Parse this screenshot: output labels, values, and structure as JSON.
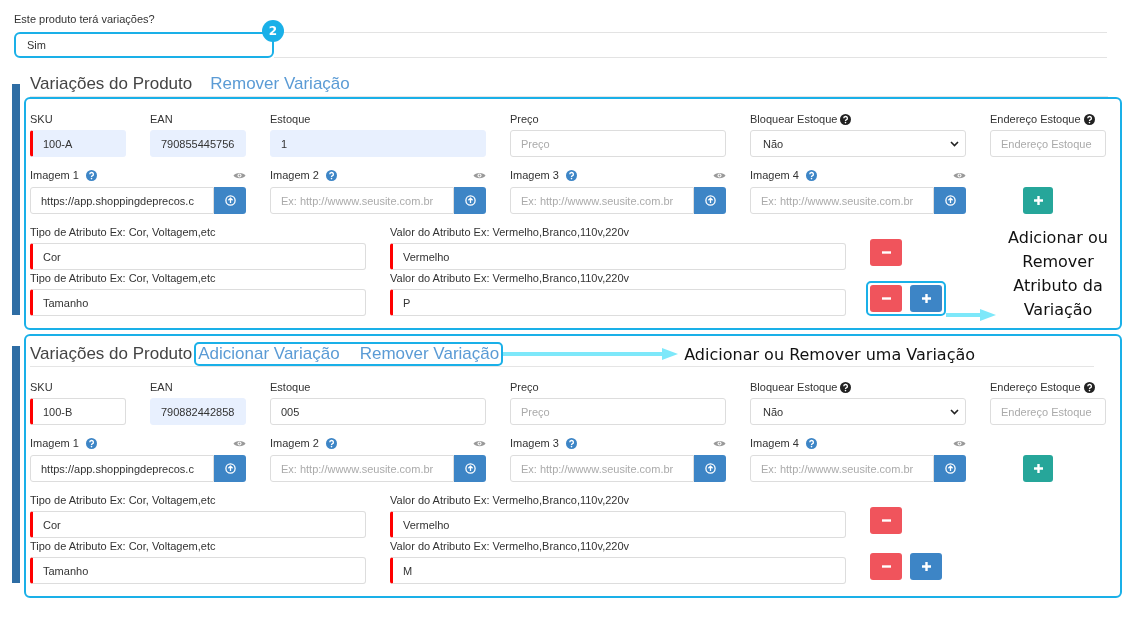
{
  "question": {
    "label": "Este produto terá variações?",
    "value": "Sim",
    "callout_number": "2"
  },
  "variations": [
    {
      "title": "Variações do Produto",
      "header_framed": false,
      "actions_highlighted": false,
      "actions": [
        {
          "label": "Remover Variação"
        }
      ],
      "fields": [
        {
          "kind": "input",
          "label": "SKU",
          "value": "100-A",
          "required": true,
          "autofilled": true
        },
        {
          "kind": "input",
          "label": "EAN",
          "value": "790855445756",
          "required": false,
          "autofilled": true
        },
        {
          "kind": "input",
          "label": "Estoque",
          "value": "1",
          "required": false,
          "autofilled": true
        },
        {
          "kind": "input",
          "label": "Preço",
          "placeholder": "Preço",
          "required": false,
          "autofilled": false
        },
        {
          "kind": "select",
          "label": "Bloquear Estoque",
          "value": "Não",
          "help": true
        },
        {
          "kind": "input",
          "label": "Endereço Estoque",
          "placeholder": "Endereço Estoque",
          "required": false,
          "autofilled": false,
          "help": true
        }
      ],
      "images": [
        {
          "label": "Imagem 1",
          "value": "https://app.shoppingdeprecos.c"
        },
        {
          "label": "Imagem 2",
          "placeholder": "Ex: http://wwww.seusite.com.br"
        },
        {
          "label": "Imagem 3",
          "placeholder": "Ex: http://wwww.seusite.com.br"
        },
        {
          "label": "Imagem 4",
          "placeholder": "Ex: http://wwww.seusite.com.br"
        }
      ],
      "image_add_button": true,
      "attributes": [
        {
          "type_label": "Tipo de Atributo Ex: Cor, Voltagem,etc",
          "type_value": "Cor",
          "value_label": "Valor do Atributo Ex: Vermelho,Branco,110v,220v",
          "value": "Vermelho",
          "highlighted": false,
          "buttons": [
            {
              "kind": "remove"
            }
          ]
        },
        {
          "type_label": "Tipo de Atributo Ex: Cor, Voltagem,etc",
          "type_value": "Tamanho",
          "value_label": "Valor do Atributo Ex: Vermelho,Branco,110v,220v",
          "value": "P",
          "highlighted": true,
          "buttons": [
            {
              "kind": "remove"
            },
            {
              "kind": "add"
            }
          ],
          "callout": "Adicionar ou Remover Atributo da Variação"
        }
      ]
    },
    {
      "title": "Variações do Produto",
      "header_framed": true,
      "actions_highlighted": true,
      "actions": [
        {
          "label": "Adicionar Variação"
        },
        {
          "label": "Remover Variação"
        }
      ],
      "actions_callout": "Adicionar ou Remover uma Variação",
      "fields": [
        {
          "kind": "input",
          "label": "SKU",
          "value": "100-B",
          "required": true,
          "autofilled": false
        },
        {
          "kind": "input",
          "label": "EAN",
          "value": "790882442858",
          "required": false,
          "autofilled": true
        },
        {
          "kind": "input",
          "label": "Estoque",
          "value": "005",
          "required": false,
          "autofilled": false
        },
        {
          "kind": "input",
          "label": "Preço",
          "placeholder": "Preço",
          "required": false,
          "autofilled": false
        },
        {
          "kind": "select",
          "label": "Bloquear Estoque",
          "value": "Não",
          "help": true
        },
        {
          "kind": "input",
          "label": "Endereço Estoque",
          "placeholder": "Endereço Estoque",
          "required": false,
          "autofilled": false,
          "help": true
        }
      ],
      "images": [
        {
          "label": "Imagem 1",
          "value": "https://app.shoppingdeprecos.c"
        },
        {
          "label": "Imagem 2",
          "placeholder": "Ex: http://wwww.seusite.com.br"
        },
        {
          "label": "Imagem 3",
          "placeholder": "Ex: http://wwww.seusite.com.br"
        },
        {
          "label": "Imagem 4",
          "placeholder": "Ex: http://wwww.seusite.com.br"
        }
      ],
      "image_add_button": true,
      "attributes": [
        {
          "type_label": "Tipo de Atributo Ex: Cor, Voltagem,etc",
          "type_value": "Cor",
          "value_label": "Valor do Atributo Ex: Vermelho,Branco,110v,220v",
          "value": "Vermelho",
          "highlighted": false,
          "buttons": [
            {
              "kind": "remove"
            }
          ]
        },
        {
          "type_label": "Tipo de Atributo Ex: Cor, Voltagem,etc",
          "type_value": "Tamanho",
          "value_label": "Valor do Atributo Ex: Vermelho,Branco,110v,220v",
          "value": "M",
          "highlighted": false,
          "buttons": [
            {
              "kind": "remove"
            },
            {
              "kind": "add"
            }
          ]
        }
      ]
    }
  ]
}
